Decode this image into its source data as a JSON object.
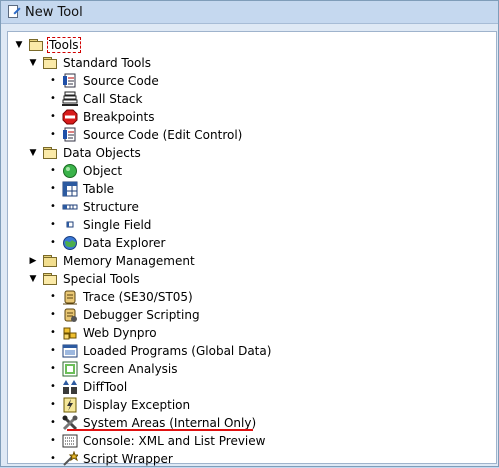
{
  "window": {
    "title": "New Tool"
  },
  "tree": {
    "root": {
      "label": "Tools"
    },
    "standard_tools": {
      "label": "Standard Tools",
      "items": [
        {
          "label": "Source Code",
          "icon": "source-code-icon"
        },
        {
          "label": "Call Stack",
          "icon": "call-stack-icon"
        },
        {
          "label": "Breakpoints",
          "icon": "stop-icon"
        },
        {
          "label": "Source Code (Edit Control)",
          "icon": "source-code-edit-icon"
        }
      ]
    },
    "data_objects": {
      "label": "Data Objects",
      "items": [
        {
          "label": "Object",
          "icon": "object-icon"
        },
        {
          "label": "Table",
          "icon": "table-icon"
        },
        {
          "label": "Structure",
          "icon": "structure-icon"
        },
        {
          "label": "Single Field",
          "icon": "single-field-icon"
        },
        {
          "label": "Data Explorer",
          "icon": "data-explorer-icon"
        }
      ]
    },
    "memory_management": {
      "label": "Memory Management"
    },
    "special_tools": {
      "label": "Special Tools",
      "items": [
        {
          "label": "Trace (SE30/ST05)",
          "icon": "trace-icon"
        },
        {
          "label": "Debugger Scripting",
          "icon": "scripting-icon"
        },
        {
          "label": "Web Dynpro",
          "icon": "web-dynpro-icon"
        },
        {
          "label": "Loaded Programs (Global Data)",
          "icon": "loaded-programs-icon"
        },
        {
          "label": "Screen Analysis",
          "icon": "screen-analysis-icon"
        },
        {
          "label": "DiffTool",
          "icon": "difftool-icon"
        },
        {
          "label": "Display Exception",
          "icon": "exception-icon"
        },
        {
          "label": "System Areas (Internal Only)",
          "icon": "system-areas-icon"
        },
        {
          "label": "Console: XML and List Preview",
          "icon": "console-icon"
        },
        {
          "label": "Script Wrapper",
          "icon": "script-wrapper-icon"
        }
      ]
    }
  },
  "colors": {
    "highlight_underline": "#e01010",
    "selection_outline": "#d10000"
  }
}
